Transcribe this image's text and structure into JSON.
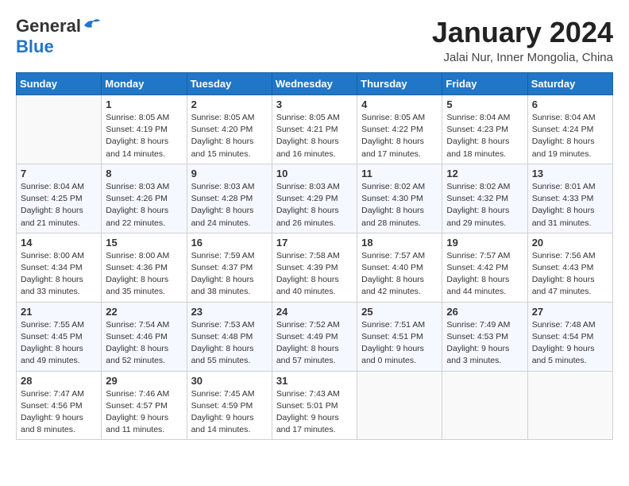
{
  "header": {
    "logo_general": "General",
    "logo_blue": "Blue",
    "month_title": "January 2024",
    "location": "Jalai Nur, Inner Mongolia, China"
  },
  "weekdays": [
    "Sunday",
    "Monday",
    "Tuesday",
    "Wednesday",
    "Thursday",
    "Friday",
    "Saturday"
  ],
  "weeks": [
    [
      {
        "day": "",
        "sunrise": "",
        "sunset": "",
        "daylight": ""
      },
      {
        "day": "1",
        "sunrise": "Sunrise: 8:05 AM",
        "sunset": "Sunset: 4:19 PM",
        "daylight": "Daylight: 8 hours and 14 minutes."
      },
      {
        "day": "2",
        "sunrise": "Sunrise: 8:05 AM",
        "sunset": "Sunset: 4:20 PM",
        "daylight": "Daylight: 8 hours and 15 minutes."
      },
      {
        "day": "3",
        "sunrise": "Sunrise: 8:05 AM",
        "sunset": "Sunset: 4:21 PM",
        "daylight": "Daylight: 8 hours and 16 minutes."
      },
      {
        "day": "4",
        "sunrise": "Sunrise: 8:05 AM",
        "sunset": "Sunset: 4:22 PM",
        "daylight": "Daylight: 8 hours and 17 minutes."
      },
      {
        "day": "5",
        "sunrise": "Sunrise: 8:04 AM",
        "sunset": "Sunset: 4:23 PM",
        "daylight": "Daylight: 8 hours and 18 minutes."
      },
      {
        "day": "6",
        "sunrise": "Sunrise: 8:04 AM",
        "sunset": "Sunset: 4:24 PM",
        "daylight": "Daylight: 8 hours and 19 minutes."
      }
    ],
    [
      {
        "day": "7",
        "sunrise": "Sunrise: 8:04 AM",
        "sunset": "Sunset: 4:25 PM",
        "daylight": "Daylight: 8 hours and 21 minutes."
      },
      {
        "day": "8",
        "sunrise": "Sunrise: 8:03 AM",
        "sunset": "Sunset: 4:26 PM",
        "daylight": "Daylight: 8 hours and 22 minutes."
      },
      {
        "day": "9",
        "sunrise": "Sunrise: 8:03 AM",
        "sunset": "Sunset: 4:28 PM",
        "daylight": "Daylight: 8 hours and 24 minutes."
      },
      {
        "day": "10",
        "sunrise": "Sunrise: 8:03 AM",
        "sunset": "Sunset: 4:29 PM",
        "daylight": "Daylight: 8 hours and 26 minutes."
      },
      {
        "day": "11",
        "sunrise": "Sunrise: 8:02 AM",
        "sunset": "Sunset: 4:30 PM",
        "daylight": "Daylight: 8 hours and 28 minutes."
      },
      {
        "day": "12",
        "sunrise": "Sunrise: 8:02 AM",
        "sunset": "Sunset: 4:32 PM",
        "daylight": "Daylight: 8 hours and 29 minutes."
      },
      {
        "day": "13",
        "sunrise": "Sunrise: 8:01 AM",
        "sunset": "Sunset: 4:33 PM",
        "daylight": "Daylight: 8 hours and 31 minutes."
      }
    ],
    [
      {
        "day": "14",
        "sunrise": "Sunrise: 8:00 AM",
        "sunset": "Sunset: 4:34 PM",
        "daylight": "Daylight: 8 hours and 33 minutes."
      },
      {
        "day": "15",
        "sunrise": "Sunrise: 8:00 AM",
        "sunset": "Sunset: 4:36 PM",
        "daylight": "Daylight: 8 hours and 35 minutes."
      },
      {
        "day": "16",
        "sunrise": "Sunrise: 7:59 AM",
        "sunset": "Sunset: 4:37 PM",
        "daylight": "Daylight: 8 hours and 38 minutes."
      },
      {
        "day": "17",
        "sunrise": "Sunrise: 7:58 AM",
        "sunset": "Sunset: 4:39 PM",
        "daylight": "Daylight: 8 hours and 40 minutes."
      },
      {
        "day": "18",
        "sunrise": "Sunrise: 7:57 AM",
        "sunset": "Sunset: 4:40 PM",
        "daylight": "Daylight: 8 hours and 42 minutes."
      },
      {
        "day": "19",
        "sunrise": "Sunrise: 7:57 AM",
        "sunset": "Sunset: 4:42 PM",
        "daylight": "Daylight: 8 hours and 44 minutes."
      },
      {
        "day": "20",
        "sunrise": "Sunrise: 7:56 AM",
        "sunset": "Sunset: 4:43 PM",
        "daylight": "Daylight: 8 hours and 47 minutes."
      }
    ],
    [
      {
        "day": "21",
        "sunrise": "Sunrise: 7:55 AM",
        "sunset": "Sunset: 4:45 PM",
        "daylight": "Daylight: 8 hours and 49 minutes."
      },
      {
        "day": "22",
        "sunrise": "Sunrise: 7:54 AM",
        "sunset": "Sunset: 4:46 PM",
        "daylight": "Daylight: 8 hours and 52 minutes."
      },
      {
        "day": "23",
        "sunrise": "Sunrise: 7:53 AM",
        "sunset": "Sunset: 4:48 PM",
        "daylight": "Daylight: 8 hours and 55 minutes."
      },
      {
        "day": "24",
        "sunrise": "Sunrise: 7:52 AM",
        "sunset": "Sunset: 4:49 PM",
        "daylight": "Daylight: 8 hours and 57 minutes."
      },
      {
        "day": "25",
        "sunrise": "Sunrise: 7:51 AM",
        "sunset": "Sunset: 4:51 PM",
        "daylight": "Daylight: 9 hours and 0 minutes."
      },
      {
        "day": "26",
        "sunrise": "Sunrise: 7:49 AM",
        "sunset": "Sunset: 4:53 PM",
        "daylight": "Daylight: 9 hours and 3 minutes."
      },
      {
        "day": "27",
        "sunrise": "Sunrise: 7:48 AM",
        "sunset": "Sunset: 4:54 PM",
        "daylight": "Daylight: 9 hours and 5 minutes."
      }
    ],
    [
      {
        "day": "28",
        "sunrise": "Sunrise: 7:47 AM",
        "sunset": "Sunset: 4:56 PM",
        "daylight": "Daylight: 9 hours and 8 minutes."
      },
      {
        "day": "29",
        "sunrise": "Sunrise: 7:46 AM",
        "sunset": "Sunset: 4:57 PM",
        "daylight": "Daylight: 9 hours and 11 minutes."
      },
      {
        "day": "30",
        "sunrise": "Sunrise: 7:45 AM",
        "sunset": "Sunset: 4:59 PM",
        "daylight": "Daylight: 9 hours and 14 minutes."
      },
      {
        "day": "31",
        "sunrise": "Sunrise: 7:43 AM",
        "sunset": "Sunset: 5:01 PM",
        "daylight": "Daylight: 9 hours and 17 minutes."
      },
      {
        "day": "",
        "sunrise": "",
        "sunset": "",
        "daylight": ""
      },
      {
        "day": "",
        "sunrise": "",
        "sunset": "",
        "daylight": ""
      },
      {
        "day": "",
        "sunrise": "",
        "sunset": "",
        "daylight": ""
      }
    ]
  ]
}
